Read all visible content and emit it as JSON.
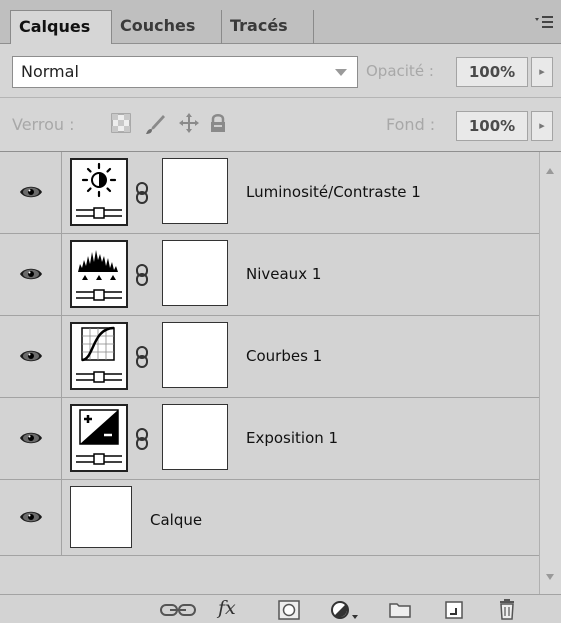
{
  "tabs": [
    {
      "label": "Calques",
      "active": true
    },
    {
      "label": "Couches",
      "active": false
    },
    {
      "label": "Tracés",
      "active": false
    }
  ],
  "panel_menu_icon": "panel-menu-icon",
  "blend": {
    "mode": "Normal",
    "opacity_label": "Opacité :",
    "opacity_value": "100%"
  },
  "lock": {
    "label": "Verrou :",
    "icons": [
      "lock-transparency-icon",
      "lock-pixels-icon",
      "lock-position-icon",
      "lock-all-icon"
    ],
    "fill_label": "Fond :",
    "fill_value": "100%"
  },
  "layers": [
    {
      "name": "Luminosité/Contraste 1",
      "type": "adjustment",
      "icon": "brightness-contrast-icon",
      "visible": true
    },
    {
      "name": "Niveaux 1",
      "type": "adjustment",
      "icon": "levels-icon",
      "visible": true
    },
    {
      "name": "Courbes 1",
      "type": "adjustment",
      "icon": "curves-icon",
      "visible": true
    },
    {
      "name": "Exposition 1",
      "type": "adjustment",
      "icon": "exposure-icon",
      "visible": true
    },
    {
      "name": "Calque",
      "type": "pixel",
      "icon": "layer-thumbnail",
      "visible": true
    }
  ],
  "bottom_toolbar": {
    "icons": [
      "link-layers-icon",
      "fx-icon",
      "add-mask-icon",
      "new-adjustment-icon",
      "new-group-icon",
      "new-layer-icon",
      "delete-icon"
    ],
    "fx_label": "fx"
  },
  "colors": {
    "panel_bg": "#d3d3d3",
    "tab_bar_bg": "#bfbfbf",
    "disabled_text": "#a8a8a8"
  }
}
